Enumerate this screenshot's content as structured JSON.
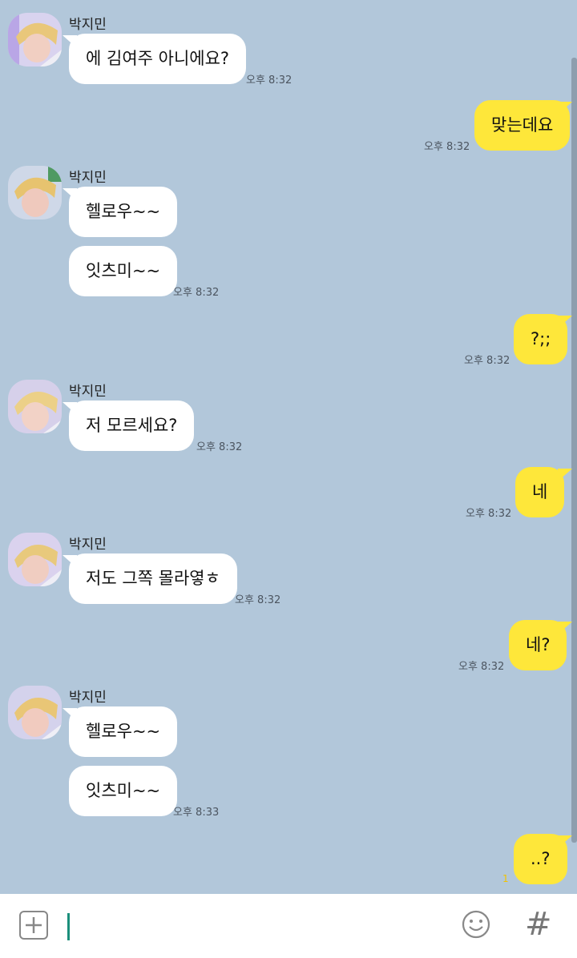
{
  "chat": {
    "sender_name": "박지민",
    "messages": {
      "m1": {
        "text": "에 김여주 아니에요?",
        "time": "오후 8:32"
      },
      "m2": {
        "text": "맞는데요",
        "time": "오후 8:32"
      },
      "m3": {
        "text": "헬로우~~"
      },
      "m4": {
        "text": "잇츠미~~",
        "time": "오후 8:32"
      },
      "m5": {
        "text": "?;;",
        "time": "오후 8:32"
      },
      "m6": {
        "text": "저 모르세요?",
        "time": "오후 8:32"
      },
      "m7": {
        "text": "네",
        "time": "오후 8:32"
      },
      "m8": {
        "text": "저도 그쪽 몰라옇ㅎ",
        "time": "오후 8:32"
      },
      "m9": {
        "text": "네?",
        "time": "오후 8:32"
      },
      "m10": {
        "text": "헬로우~~"
      },
      "m11": {
        "text": "잇츠미~~",
        "time": "오후 8:33"
      },
      "m12": {
        "text": "..?",
        "unread": "1"
      }
    }
  },
  "input_bar": {
    "plus_icon": "plus-square-icon",
    "emoji_icon": "smiley-icon",
    "hash_label": "#"
  },
  "colors": {
    "background": "#b2c7da",
    "incoming_bubble": "#ffffff",
    "outgoing_bubble": "#fee73a",
    "cursor": "#1b8f7b"
  }
}
